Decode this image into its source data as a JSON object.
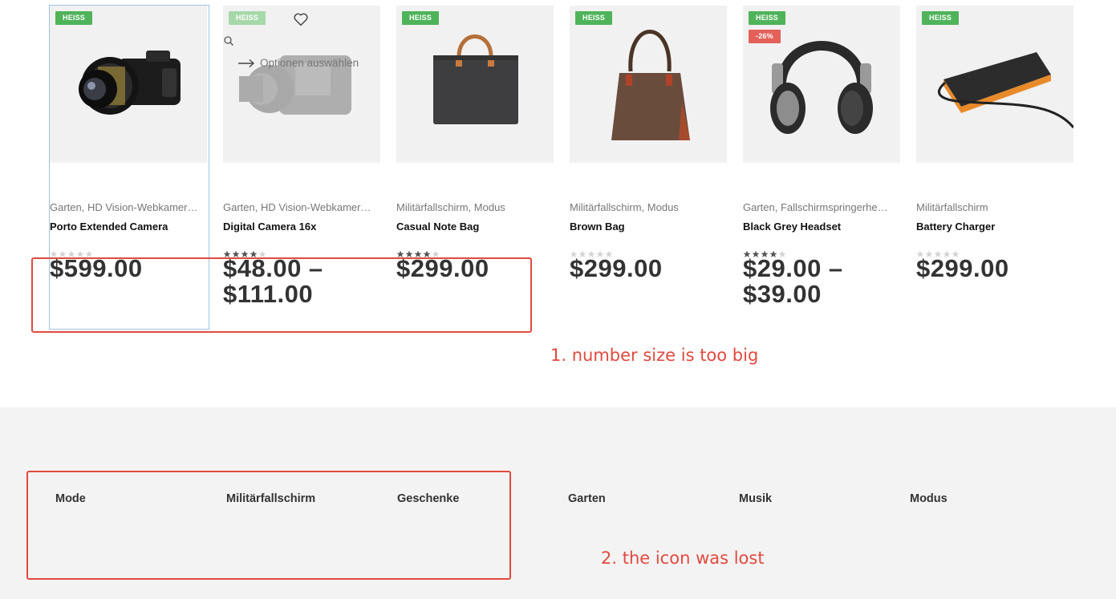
{
  "products": [
    {
      "badges": [
        "HEISS"
      ],
      "categories": "Garten, HD Vision-Webkamer…",
      "title": "Porto Extended Camera",
      "rating": 0,
      "price": "$599.00"
    },
    {
      "badges": [
        "HEISS"
      ],
      "categories": "Garten, HD Vision-Webkamer…",
      "title": "Digital Camera 16x",
      "rating": 4,
      "price": "$48.00 – $111.00",
      "hover_action": "Optionen auswählen"
    },
    {
      "badges": [
        "HEISS"
      ],
      "categories": "Militärfallschirm, Modus",
      "title": "Casual Note Bag",
      "rating": 4,
      "price": "$299.00"
    },
    {
      "badges": [
        "HEISS"
      ],
      "categories": "Militärfallschirm, Modus",
      "title": "Brown Bag",
      "rating": 0,
      "price": "$299.00"
    },
    {
      "badges": [
        "HEISS",
        "-26%"
      ],
      "categories": "Garten, Fallschirmspringerhe…",
      "title": "Black Grey Headset",
      "rating": 4,
      "price": "$29.00 – $39.00"
    },
    {
      "badges": [
        "HEISS"
      ],
      "categories": "Militärfallschirm",
      "title": "Battery Charger",
      "rating": 0,
      "price": "$299.00"
    }
  ],
  "annotations": {
    "note1": "1. number size is too big",
    "note2": "2. the icon was lost"
  },
  "footer_categories": [
    "Mode",
    "Militärfallschirm",
    "Geschenke",
    "Garten",
    "Musik",
    "Modus"
  ],
  "colors": {
    "hot_badge": "#4fb35a",
    "sale_badge": "#e36159",
    "annotation": "#e04a3f"
  }
}
